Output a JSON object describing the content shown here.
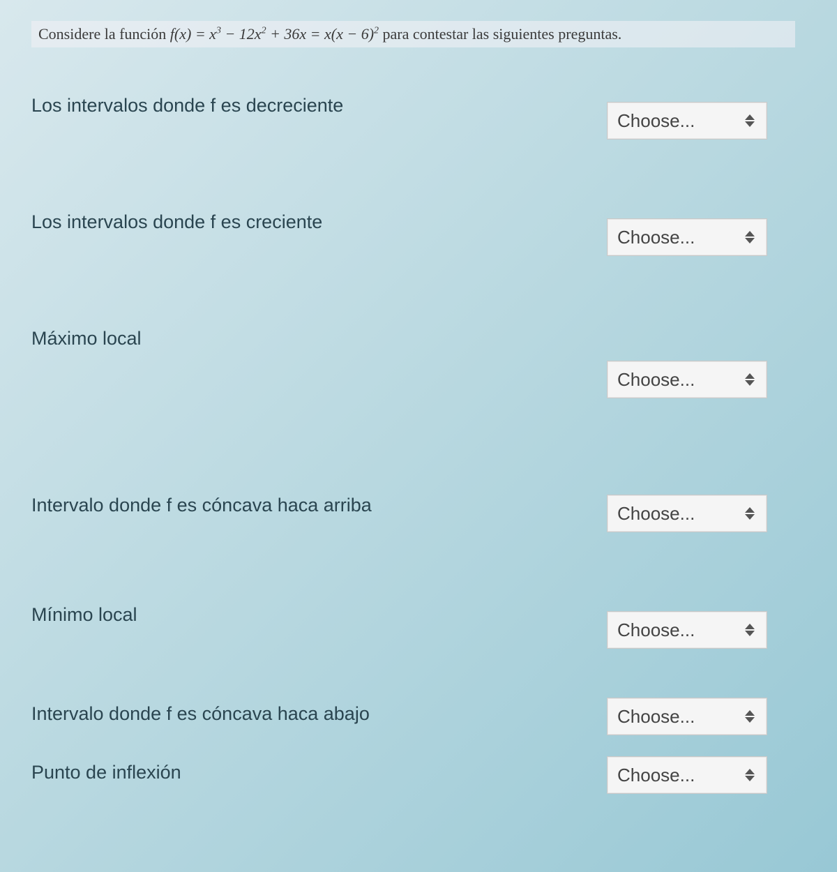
{
  "instruction": {
    "prefix": "Considere la función ",
    "func": "f(x) = x³ − 12x² + 36x = x(x − 6)²",
    "suffix": " para contestar las siguientes preguntas."
  },
  "dropdown_placeholder": "Choose...",
  "questions": [
    {
      "label": "Los intervalos donde f es decreciente"
    },
    {
      "label": "Los intervalos donde f es creciente"
    },
    {
      "label": "Máximo local"
    },
    {
      "label": "Intervalo donde f es cóncava haca arriba"
    },
    {
      "label": "Mínimo local"
    },
    {
      "label": "Intervalo donde f es cóncava haca abajo"
    },
    {
      "label": "Punto de inflexión"
    }
  ]
}
